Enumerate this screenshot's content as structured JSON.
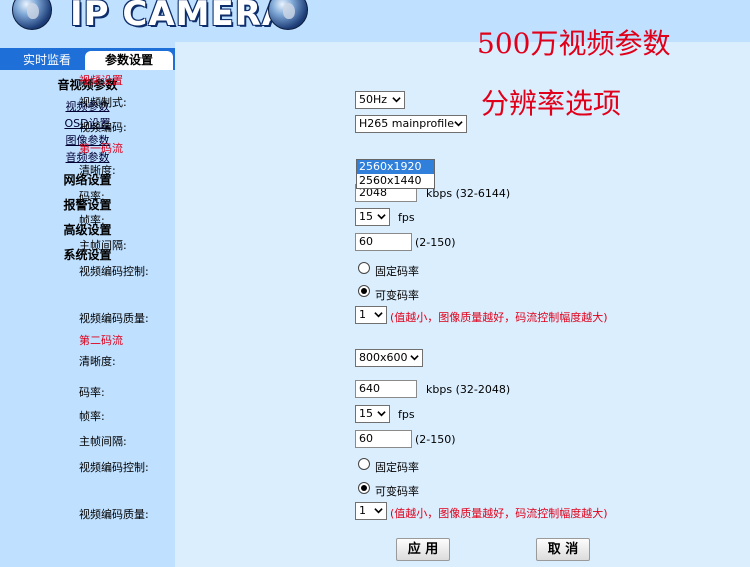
{
  "header": {
    "brand": "IP CAMERA"
  },
  "annotations": {
    "line1": "500万视频参数",
    "line2": "分辨率选项"
  },
  "tabs": [
    {
      "label": "实时监看"
    },
    {
      "label": "参数设置"
    }
  ],
  "sidebar": {
    "av_title": "音视频参数",
    "av_items": [
      "视频参数",
      "OSD设置",
      "图像参数",
      "音频参数"
    ],
    "network": "网络设置",
    "alarm": "报警设置",
    "advanced": "高级设置",
    "system": "系统设置"
  },
  "video": {
    "section_title": "视频设置",
    "format_label": "视频制式:",
    "format_value": "50Hz",
    "codec_label": "视频编码:",
    "codec_value": "H265 mainprofile"
  },
  "stream1": {
    "section_title": "第一码流",
    "resolution_label": "清晰度:",
    "resolution_options": [
      "2560x1920",
      "2560x1440"
    ],
    "resolution_selected": "2560x1920",
    "bitrate_label": "码率:",
    "bitrate_value": "2048",
    "bitrate_range": "kbps (32-6144)",
    "fps_label": "帧率:",
    "fps_value": "15",
    "fps_unit": "fps",
    "gop_label": "主帧间隔:",
    "gop_value": "60",
    "gop_range": "(2-150)",
    "ctrl_label": "视频编码控制:",
    "ctrl_cbr": "固定码率",
    "ctrl_vbr": "可变码率",
    "quality_label": "视频编码质量:",
    "quality_value": "1",
    "quality_hint": "(值越小，图像质量越好，码流控制幅度越大)"
  },
  "stream2": {
    "section_title": "第二码流",
    "resolution_label": "清晰度:",
    "resolution_value": "800x600",
    "bitrate_label": "码率:",
    "bitrate_value": "640",
    "bitrate_range": "kbps (32-2048)",
    "fps_label": "帧率:",
    "fps_value": "15",
    "fps_unit": "fps",
    "gop_label": "主帧间隔:",
    "gop_value": "60",
    "gop_range": "(2-150)",
    "ctrl_label": "视频编码控制:",
    "ctrl_cbr": "固定码率",
    "ctrl_vbr": "可变码率",
    "quality_label": "视频编码质量:",
    "quality_value": "1",
    "quality_hint": "(值越小，图像质量越好，码流控制幅度越大)"
  },
  "buttons": {
    "apply": "应 用",
    "cancel": "取 消"
  }
}
